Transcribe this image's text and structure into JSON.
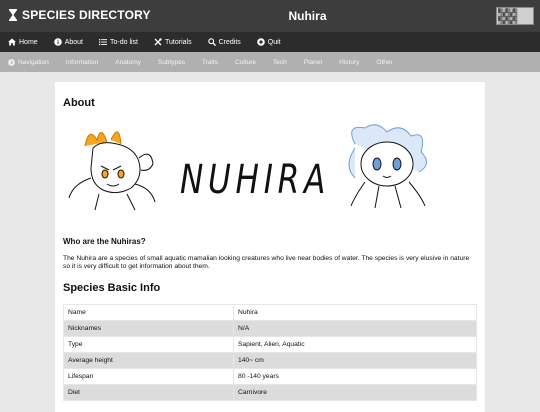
{
  "header": {
    "brand": "SPECIES DIRECTORY",
    "title": "Nuhira"
  },
  "mainnav": [
    {
      "label": "Home",
      "icon": "home-icon"
    },
    {
      "label": "About",
      "icon": "info-icon"
    },
    {
      "label": "To-do list",
      "icon": "list-icon"
    },
    {
      "label": "Tutorials",
      "icon": "tools-icon"
    },
    {
      "label": "Credits",
      "icon": "search-icon"
    },
    {
      "label": "Quit",
      "icon": "circle-icon"
    }
  ],
  "subnav": [
    {
      "label": "Navigation",
      "icon": "chevron-right-icon"
    },
    {
      "label": "Information"
    },
    {
      "label": "Anatomy"
    },
    {
      "label": "Subtypes"
    },
    {
      "label": "Traits"
    },
    {
      "label": "Culture"
    },
    {
      "label": "Tech"
    },
    {
      "label": "Planet"
    },
    {
      "label": "History"
    },
    {
      "label": "Other"
    }
  ],
  "about": {
    "heading": "About",
    "wordmark": "NUHIRA",
    "who_heading": "Who are the Nuhiras?",
    "description": "The Nuhira are a species of small aquatic mamalian looking creatures who live near bodies of water. The species is very elusive in nature so it is very difficult to get information about them."
  },
  "basic_info": {
    "heading": "Species Basic Info",
    "rows": [
      {
        "label": "Name",
        "value": "Nuhira"
      },
      {
        "label": "Nicknames",
        "value": "N/A"
      },
      {
        "label": "Type",
        "value": "Sapient, Alien, Aquatic"
      },
      {
        "label": "Average height",
        "value": "140~ cm"
      },
      {
        "label": "Lifespan",
        "value": "80 -140 years"
      },
      {
        "label": "Diet",
        "value": "Carnivore"
      }
    ]
  },
  "colors": {
    "topbar": "#3d3d3d",
    "mainnav": "#2c2c2c",
    "subnav": "#b0b0b0",
    "fire_accent": "#f5a623",
    "water_accent": "#6f9fd8"
  }
}
